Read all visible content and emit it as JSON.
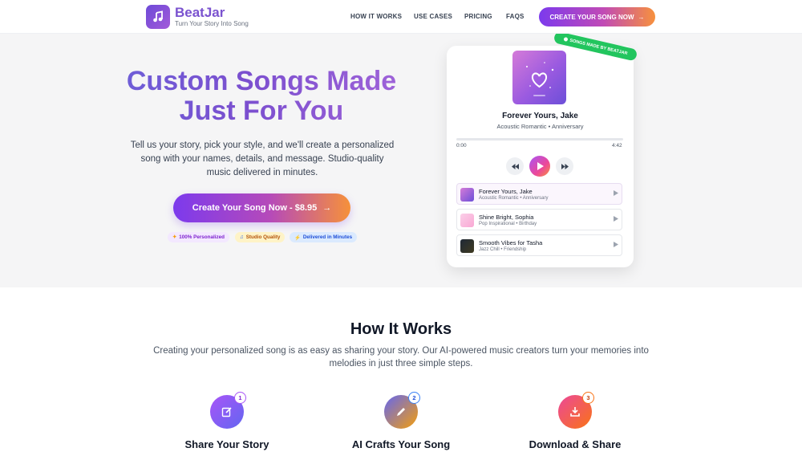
{
  "brand": {
    "name": "BeatJar",
    "tagline": "Turn Your Story Into Song"
  },
  "nav": {
    "links": [
      "HOW IT WORKS",
      "USE CASES",
      "PRICING",
      "FAQS"
    ],
    "cta": "CREATE YOUR SONG NOW"
  },
  "hero": {
    "title_line1": "Custom Songs Made",
    "title_line2": "Just For You",
    "subtitle": "Tell us your story, pick your style, and we'll create a personalized song with your names, details, and message. Studio-quality music delivered in minutes.",
    "cta": "Create Your Song Now - $8.95",
    "badges": [
      "100% Personalized",
      "Studio Quality",
      "Delivered in Minutes"
    ]
  },
  "player": {
    "ribbon": "SONGS MADE BY BEATJAR",
    "now_playing": {
      "title": "Forever Yours, Jake",
      "meta": "Acoustic Romantic • Anniversary"
    },
    "time_current": "0:00",
    "time_total": "4:42",
    "progress": 0,
    "tracks": [
      {
        "title": "Forever Yours, Jake",
        "meta": "Acoustic Romantic • Anniversary"
      },
      {
        "title": "Shine Bright, Sophia",
        "meta": "Pop Inspirational • Birthday"
      },
      {
        "title": "Smooth Vibes for Tasha",
        "meta": "Jazz Chill • Friendship"
      }
    ]
  },
  "how_it_works": {
    "title": "How It Works",
    "description": "Creating your personalized song is as easy as sharing your story. Our AI-powered music creators turn your memories into melodies in just three simple steps.",
    "steps": [
      {
        "number": "1",
        "title": "Share Your Story",
        "icon": "edit-icon"
      },
      {
        "number": "2",
        "title": "AI Crafts Your Song",
        "icon": "pencil-icon"
      },
      {
        "number": "3",
        "title": "Download & Share",
        "icon": "download-icon"
      }
    ]
  }
}
